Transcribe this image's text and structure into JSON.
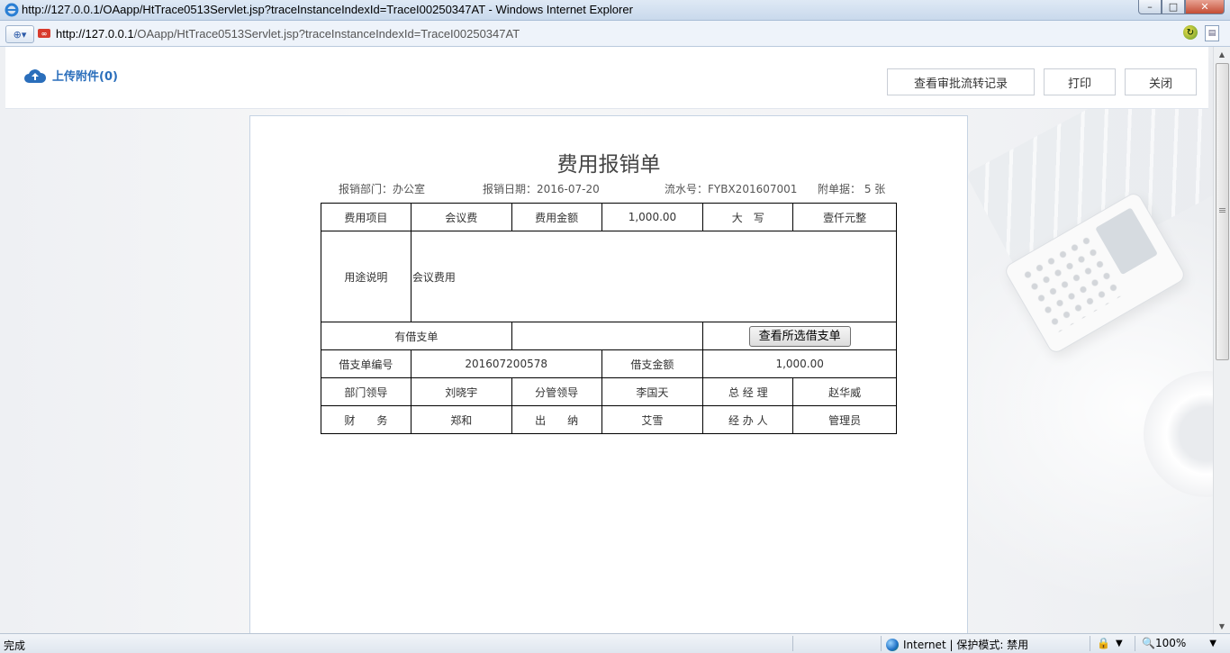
{
  "window": {
    "title": "http://127.0.0.1/OAapp/HtTrace0513Servlet.jsp?traceInstanceIndexId=TraceI00250347AT - Windows Internet Explorer",
    "btn_min": "–",
    "btn_max": "□",
    "btn_close": "✕"
  },
  "address": {
    "host": "http://127.0.0.1",
    "path": "/OAapp/HtTrace0513Servlet.jsp?traceInstanceIndexId=TraceI00250347AT",
    "url_icon": "∞"
  },
  "header": {
    "upload_label": "上传附件(0)",
    "btn_history": "查看审批流转记录",
    "btn_print": "打印",
    "btn_close": "关闭"
  },
  "doc": {
    "title": "费用报销单",
    "dept": "报销部门：办公室",
    "date": "报销日期：2016-07-20",
    "serial": "流水号：FYBX201607001",
    "attach": "附单据： 5 张"
  },
  "table": {
    "r1": [
      "费用项目",
      "会议费",
      "费用金额",
      "1,000.00",
      "大　写",
      "壹仟元整"
    ],
    "purpose_label": "用途说明",
    "purpose_value": "会议费用",
    "loan_label": "有借支单",
    "loan_value": "",
    "loan_button": "查看所选借支单",
    "r4": [
      "借支单编号",
      "201607200578",
      "借支金额",
      "1,000.00"
    ],
    "r5": [
      "部门领导",
      "刘晓宇",
      "分管领导",
      "李国天",
      "总 经 理",
      "赵华威"
    ],
    "r6": [
      "财　　务",
      "郑和",
      "出　　纳",
      "艾雪",
      "经 办 人",
      "管理员"
    ]
  },
  "status": {
    "left": "完成",
    "zone": "Internet | 保护模式: 禁用",
    "zoom": "100%"
  }
}
